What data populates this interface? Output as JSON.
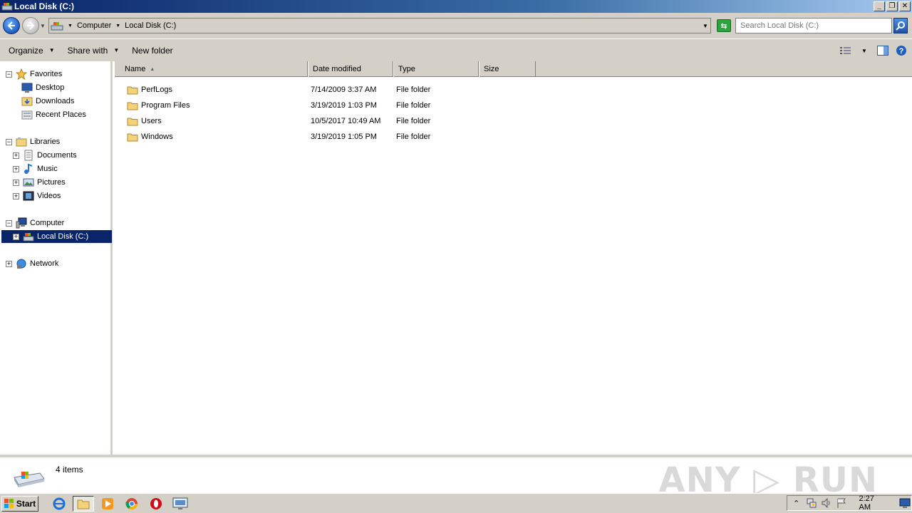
{
  "window": {
    "title": "Local Disk (C:)",
    "minimize": "_",
    "restore": "❐",
    "close": "✕"
  },
  "address": {
    "crumbs": [
      "Computer",
      "Local Disk (C:)"
    ]
  },
  "search": {
    "placeholder": "Search Local Disk (C:)"
  },
  "toolbar": {
    "organize": "Organize",
    "share_with": "Share with",
    "new_folder": "New folder"
  },
  "nav": {
    "favorites": "Favorites",
    "desktop": "Desktop",
    "downloads": "Downloads",
    "recent_places": "Recent Places",
    "libraries": "Libraries",
    "documents": "Documents",
    "music": "Music",
    "pictures": "Pictures",
    "videos": "Videos",
    "computer": "Computer",
    "local_disk": "Local Disk (C:)",
    "network": "Network"
  },
  "columns": {
    "name": "Name",
    "date_modified": "Date modified",
    "type": "Type",
    "size": "Size"
  },
  "files": [
    {
      "name": "PerfLogs",
      "date": "7/14/2009 3:37 AM",
      "type": "File folder"
    },
    {
      "name": "Program Files",
      "date": "3/19/2019 1:03 PM",
      "type": "File folder"
    },
    {
      "name": "Users",
      "date": "10/5/2017 10:49 AM",
      "type": "File folder"
    },
    {
      "name": "Windows",
      "date": "3/19/2019 1:05 PM",
      "type": "File folder"
    }
  ],
  "details": {
    "item_count": "4 items"
  },
  "watermark": "ANY ▷ RUN",
  "taskbar": {
    "start": "Start",
    "clock": "2:27 AM"
  }
}
